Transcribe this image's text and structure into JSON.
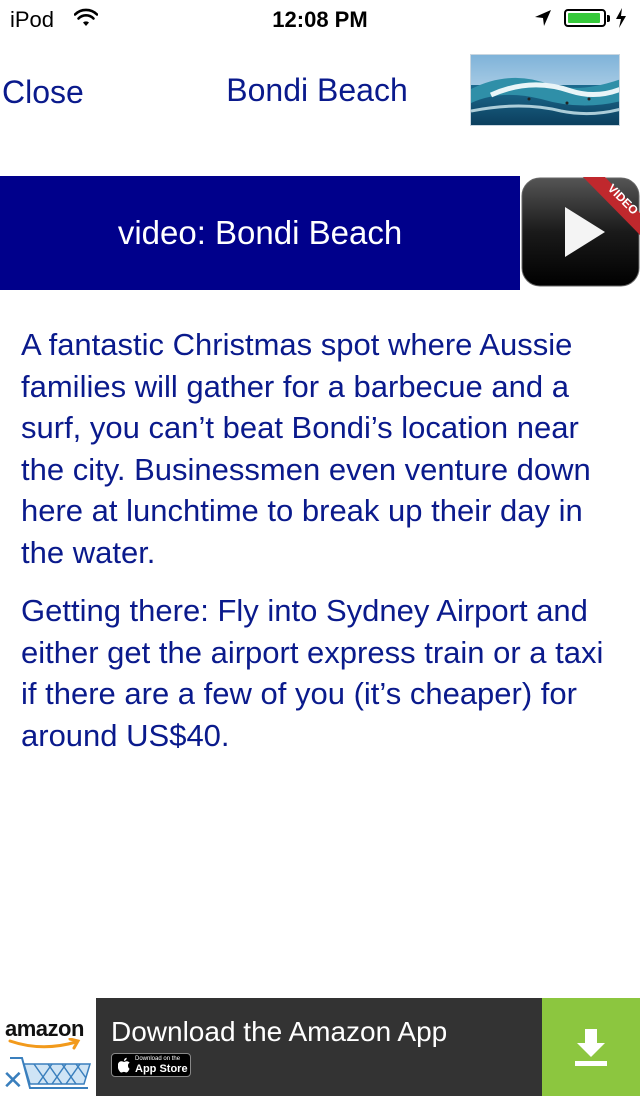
{
  "status_bar": {
    "carrier": "iPod",
    "time": "12:08 PM",
    "battery_level": 0.95,
    "battery_color": "#36c93b"
  },
  "nav": {
    "close_label": "Close",
    "title": "Bondi Beach",
    "thumbnail_icon": "beach-wave-photo"
  },
  "video": {
    "banner_label": "video: Bondi Beach",
    "play_icon": "video-play-icon",
    "ribbon_text": "VIDEO",
    "banner_color": "#00008b"
  },
  "content": {
    "paragraphs": [
      "A fantastic Christmas spot where Aussie families will gather for a barbecue and a surf, you can’t beat Bondi’s location near the city. Businessmen even venture down here at lunchtime to break up their day in the water.",
      "Getting there: Fly into Sydney Airport and either get the airport express train or a taxi if there are a few of you (it’s cheaper) for around US$40."
    ],
    "text_color": "#0a1a8c"
  },
  "ad": {
    "brand": "amazon",
    "title": "Download the Amazon App",
    "store_badge_small": "Download on the",
    "store_badge_big": "App Store",
    "close_label": "✕",
    "download_color": "#8cc63f",
    "background_color": "#333333"
  }
}
